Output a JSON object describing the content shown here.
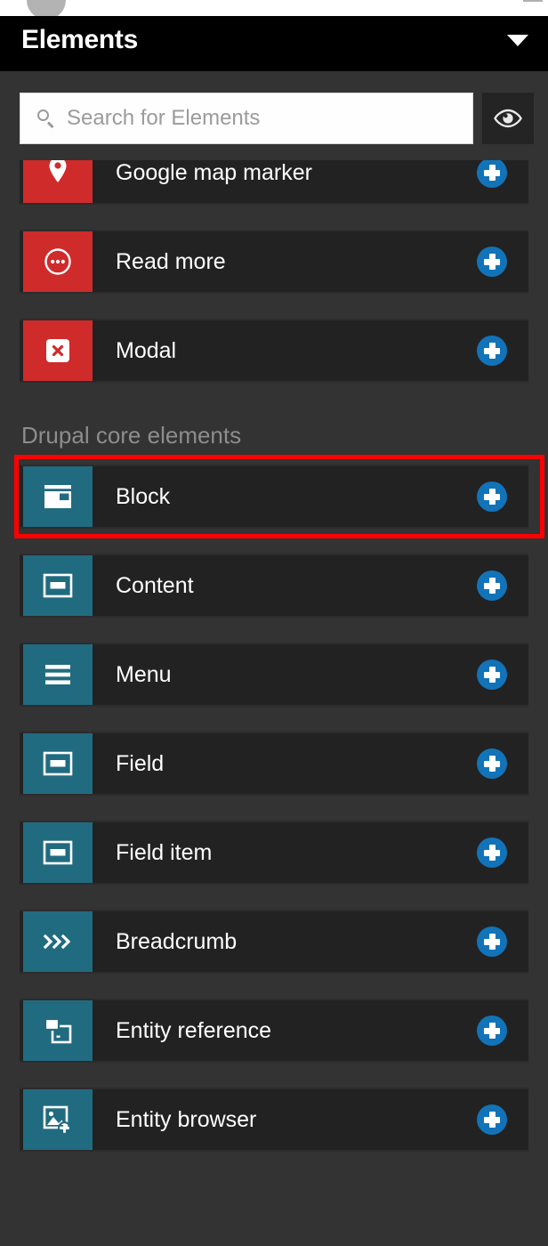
{
  "panel": {
    "title": "Elements",
    "caret_icon": "chevron-down-icon"
  },
  "search": {
    "placeholder": "Search for Elements",
    "value": "",
    "icon": "search-icon",
    "preview_toggle_icon": "eye-icon"
  },
  "colors": {
    "header_bg": "#000000",
    "panel_bg": "#333333",
    "row_bg": "#222222",
    "icon_red": "#cf2b2b",
    "icon_teal": "#216b80",
    "add_blue": "#1273b8",
    "highlight_red": "#ff0000",
    "label_white": "#ffffff",
    "heading_gray": "#8d8d8d"
  },
  "list": {
    "add_button_icon": "plus-circle-icon",
    "top_items": [
      {
        "label": "Google map marker",
        "icon": "map-marker-icon",
        "icon_color": "red"
      },
      {
        "label": "Read more",
        "icon": "ellipsis-circle-icon",
        "icon_color": "red"
      },
      {
        "label": "Modal",
        "icon": "modal-close-icon",
        "icon_color": "red"
      }
    ],
    "group": {
      "heading": "Drupal core elements",
      "items": [
        {
          "label": "Block",
          "icon": "window-block-icon",
          "icon_color": "teal",
          "highlighted": true
        },
        {
          "label": "Content",
          "icon": "content-box-icon",
          "icon_color": "teal",
          "highlighted": false
        },
        {
          "label": "Menu",
          "icon": "hamburger-menu-icon",
          "icon_color": "teal",
          "highlighted": false
        },
        {
          "label": "Field",
          "icon": "content-box-icon",
          "icon_color": "teal",
          "highlighted": false
        },
        {
          "label": "Field item",
          "icon": "content-box-icon",
          "icon_color": "teal",
          "highlighted": false
        },
        {
          "label": "Breadcrumb",
          "icon": "chevrons-right-icon",
          "icon_color": "teal",
          "highlighted": false
        },
        {
          "label": "Entity reference",
          "icon": "overlapping-frames-icon",
          "icon_color": "teal",
          "highlighted": false
        },
        {
          "label": "Entity browser",
          "icon": "image-add-icon",
          "icon_color": "teal",
          "highlighted": false
        }
      ]
    }
  }
}
